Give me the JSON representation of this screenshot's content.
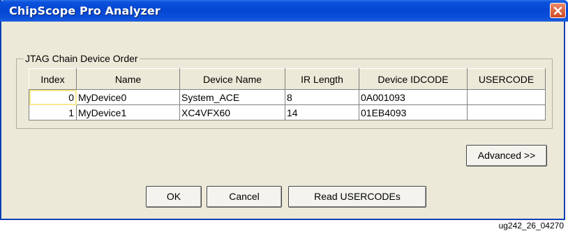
{
  "window": {
    "title": "ChipScope Pro Analyzer"
  },
  "group": {
    "label": "JTAG Chain Device Order"
  },
  "table": {
    "headers": [
      "Index",
      "Name",
      "Device Name",
      "IR Length",
      "Device IDCODE",
      "USERCODE"
    ],
    "rows": [
      [
        "0",
        "MyDevice0",
        "System_ACE",
        "8",
        "0A001093",
        ""
      ],
      [
        "1",
        "MyDevice1",
        "XC4VFX60",
        "14",
        "01EB4093",
        ""
      ]
    ]
  },
  "buttons": {
    "advanced": "Advanced >>",
    "ok": "OK",
    "cancel": "Cancel",
    "read_usercodes": "Read USERCODEs"
  },
  "footnote": "ug242_26_04270",
  "icons": {
    "close": "close-icon"
  },
  "colors": {
    "titlebar": "#0546d3",
    "close": "#d14a22",
    "dialog_bg": "#ece9d8"
  }
}
